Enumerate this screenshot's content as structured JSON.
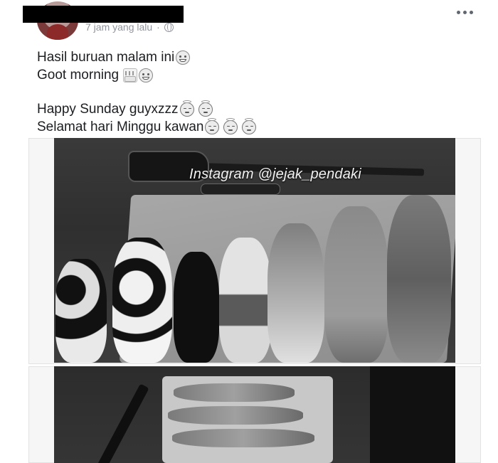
{
  "post": {
    "timestamp": "7 jam yang lalu",
    "separator": "·",
    "privacy_icon": "globe-icon",
    "more_icon": "ellipsis-icon"
  },
  "text": {
    "line1": "Hasil buruan malam ini",
    "line2": "Goot morning",
    "line3": "Happy Sunday guyxzzz",
    "line4": "Selamat hari Minggu kawan"
  },
  "photos": {
    "watermark": "Instagram @jejak_pendaki"
  }
}
